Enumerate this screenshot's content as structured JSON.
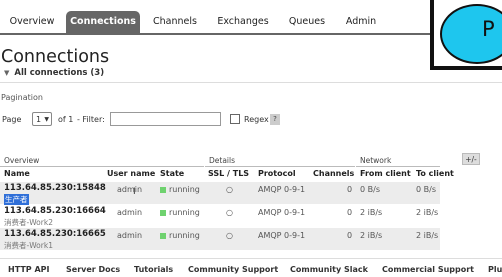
{
  "tabs": [
    "Overview",
    "Connections",
    "Channels",
    "Exchanges",
    "Queues",
    "Admin"
  ],
  "logo_letter": "P",
  "page_title": "Connections",
  "all_connections": "All connections (3)",
  "pagination": {
    "label": "Pagination",
    "page_label": "Page",
    "page_value": "1",
    "of_text": "of 1",
    "filter_label": "- Filter:",
    "filter_value": "",
    "regex_label": "Regex",
    "help": "?"
  },
  "table": {
    "groups": [
      "Overview",
      "Details",
      "Network"
    ],
    "toggle": "+/-",
    "columns": [
      "Name",
      "User name",
      "State",
      "SSL / TLS",
      "Protocol",
      "Channels",
      "From client",
      "To client"
    ],
    "rows": [
      {
        "name": "113.64.85.230:15848",
        "sub": "生产者",
        "user": "admin",
        "state": "running",
        "ssl": "○",
        "protocol": "AMQP 0-9-1",
        "channels": "0",
        "from": "0 B/s",
        "to": "0 B/s"
      },
      {
        "name": "113.64.85.230:16664",
        "sub": "消费者-Work2",
        "user": "admin",
        "state": "running",
        "ssl": "○",
        "protocol": "AMQP 0-9-1",
        "channels": "0",
        "from": "2 iB/s",
        "to": "2 iB/s"
      },
      {
        "name": "113.64.85.230:16665",
        "sub": "消费者-Work1",
        "user": "admin",
        "state": "running",
        "ssl": "○",
        "protocol": "AMQP 0-9-1",
        "channels": "0",
        "from": "2 iB/s",
        "to": "2 iB/s"
      }
    ]
  },
  "footer": [
    "HTTP API",
    "Server Docs",
    "Tutorials",
    "Community Support",
    "Community Slack",
    "Commercial Support",
    "Plu"
  ]
}
